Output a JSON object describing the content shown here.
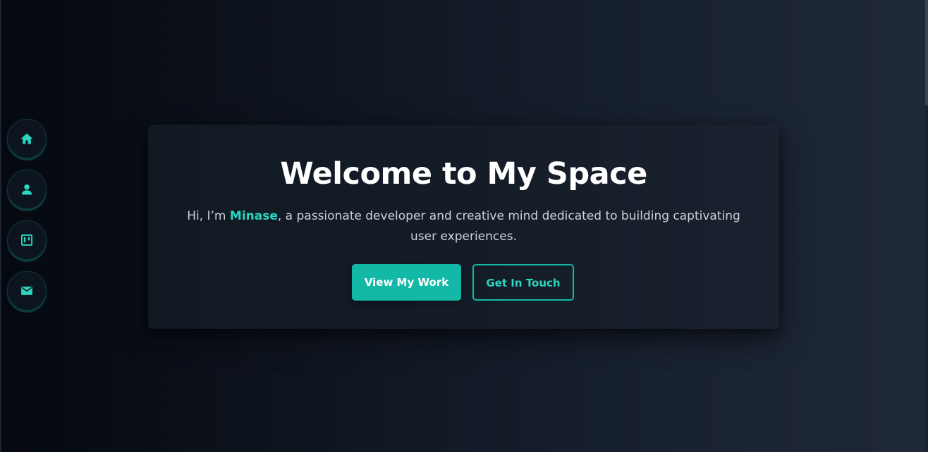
{
  "colors": {
    "accent": "#14b8a6",
    "accent_light": "#2dd4bf",
    "background_dark": "#05080f",
    "background_light": "#1f2837",
    "text_muted": "#cdd3dc"
  },
  "sidebar": {
    "items": [
      {
        "icon": "home-icon"
      },
      {
        "icon": "user-icon"
      },
      {
        "icon": "board-icon"
      },
      {
        "icon": "mail-icon"
      }
    ]
  },
  "hero": {
    "title": "Welcome to My Space",
    "intro_prefix": "Hi, I’m ",
    "intro_name": "Minase",
    "intro_suffix": ", a passionate developer and creative mind dedicated to building captivating user experiences.",
    "primary_button": "View My Work",
    "secondary_button": "Get In Touch"
  }
}
